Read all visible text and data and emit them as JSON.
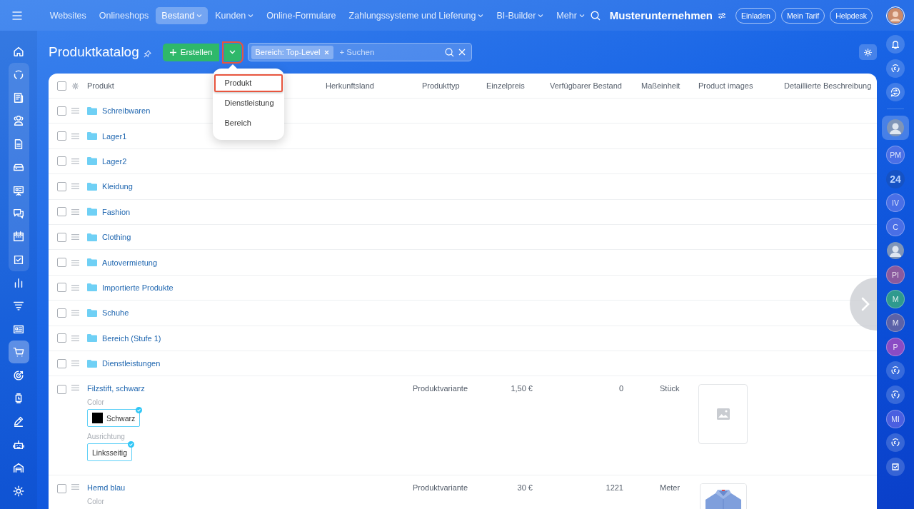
{
  "top_nav": {
    "items": [
      {
        "label": "Websites",
        "selected": false,
        "dropdown": false
      },
      {
        "label": "Onlineshops",
        "selected": false,
        "dropdown": false
      },
      {
        "label": "Bestand",
        "selected": true,
        "dropdown": true
      },
      {
        "label": "Kunden",
        "selected": false,
        "dropdown": true
      },
      {
        "label": "Online-Formulare",
        "selected": false,
        "dropdown": false
      },
      {
        "label": "Zahlungssysteme und Lieferung",
        "selected": false,
        "dropdown": true
      },
      {
        "label": "BI-Builder",
        "selected": false,
        "dropdown": true
      },
      {
        "label": "Mehr",
        "selected": false,
        "dropdown": true
      }
    ],
    "company": "Musterunternehmen",
    "buttons": [
      "Einladen",
      "Mein Tarif",
      "Helpdesk"
    ]
  },
  "left_sidebar": {
    "items": [
      {
        "selected": false,
        "grouped": false
      },
      {
        "selected": false,
        "grouped": true
      },
      {
        "selected": false,
        "grouped": true
      },
      {
        "selected": false,
        "grouped": true
      },
      {
        "selected": false,
        "grouped": true
      },
      {
        "selected": false,
        "grouped": true
      },
      {
        "selected": false,
        "grouped": true
      },
      {
        "selected": false,
        "grouped": true
      },
      {
        "selected": false,
        "grouped": true
      },
      {
        "selected": false,
        "grouped": true
      },
      {
        "selected": false,
        "grouped": false
      },
      {
        "selected": false,
        "grouped": false
      },
      {
        "selected": false,
        "grouped": false
      },
      {
        "selected": true,
        "grouped": false
      },
      {
        "selected": false,
        "grouped": false
      },
      {
        "selected": false,
        "grouped": false
      },
      {
        "selected": false,
        "grouped": false
      },
      {
        "selected": false,
        "grouped": false
      },
      {
        "selected": false,
        "grouped": false
      },
      {
        "selected": false,
        "grouped": false
      }
    ]
  },
  "toolbar": {
    "title": "Produktkatalog",
    "create_button": "Erstellen",
    "create_toggle_highlighted": true,
    "filter_chip": "Bereich: Top-Level",
    "search_placeholder": "+ Suchen"
  },
  "create_menu": {
    "items": [
      {
        "label": "Produkt",
        "selected": true
      },
      {
        "label": "Dienstleistung",
        "selected": false
      },
      {
        "label": "Bereich",
        "selected": false
      }
    ]
  },
  "table": {
    "select_all_checked": false,
    "columns": [
      "Produkt",
      "Herkunftsland",
      "Produkttyp",
      "Einzelpreis",
      "Verfügbarer Bestand",
      "Maßeinheit",
      "Product images",
      "Detaillierte Beschreibung"
    ],
    "rows": [
      {
        "kind": "folder",
        "name": "Schreibwaren",
        "checked": false
      },
      {
        "kind": "folder",
        "name": "Lager1",
        "checked": false
      },
      {
        "kind": "folder",
        "name": "Lager2",
        "checked": false
      },
      {
        "kind": "folder",
        "name": "Kleidung",
        "checked": false
      },
      {
        "kind": "folder",
        "name": "Fashion",
        "checked": false
      },
      {
        "kind": "folder",
        "name": "Clothing",
        "checked": false
      },
      {
        "kind": "folder",
        "name": "Autovermietung",
        "checked": false
      },
      {
        "kind": "folder",
        "name": "Importierte Produkte",
        "checked": false
      },
      {
        "kind": "folder",
        "name": "Schuhe",
        "checked": false
      },
      {
        "kind": "folder",
        "name": "Bereich (Stufe 1)",
        "checked": false
      },
      {
        "kind": "folder",
        "name": "Dienstleistungen",
        "checked": false
      },
      {
        "kind": "product",
        "name": "Filzstift, schwarz",
        "checked": false,
        "type": "Produktvariante",
        "price": "1,50 €",
        "stock": "0",
        "unit": "Stück",
        "image": {
          "kind": "placeholder"
        },
        "properties": [
          {
            "label": "Color",
            "value": "Schwarz",
            "color": "#000000"
          },
          {
            "label": "Ausrichtung",
            "value": "Linksseitig"
          }
        ]
      },
      {
        "kind": "product",
        "name": "Hemd blau",
        "checked": false,
        "type": "Produktvariante",
        "price": "30 €",
        "stock": "1221",
        "unit": "Meter",
        "image": {
          "kind": "picture"
        },
        "properties": [
          {
            "label": "Color"
          }
        ]
      }
    ]
  },
  "right_sidebar": {
    "items": [
      {
        "kind": "icon",
        "selected": false
      },
      {
        "kind": "icon",
        "selected": false
      },
      {
        "kind": "icon",
        "selected": false
      },
      {
        "kind": "avatar",
        "selected": true
      },
      {
        "kind": "initials",
        "text": "PM",
        "color": "#4a6fe6",
        "selected": false
      },
      {
        "kind": "logo",
        "text": "24",
        "selected": false
      },
      {
        "kind": "initials",
        "text": "IV",
        "color": "#4a6fe6",
        "selected": false
      },
      {
        "kind": "initials",
        "text": "C",
        "color": "#4a6fe6",
        "selected": false
      },
      {
        "kind": "avatar",
        "selected": false
      },
      {
        "kind": "initials",
        "text": "PI",
        "color": "#8a5a9e",
        "selected": false
      },
      {
        "kind": "initials",
        "text": "M",
        "color": "#2f9a8e",
        "selected": false
      },
      {
        "kind": "initials",
        "text": "M",
        "color": "#5b62a8",
        "selected": false
      },
      {
        "kind": "initials",
        "text": "P",
        "color": "#8a4cc4",
        "selected": false
      },
      {
        "kind": "icon",
        "selected": false
      },
      {
        "kind": "icon",
        "selected": false
      },
      {
        "kind": "initials",
        "text": "MI",
        "color": "#4a5fe0",
        "selected": false
      },
      {
        "kind": "icon",
        "selected": false
      },
      {
        "kind": "icon",
        "selected": false
      }
    ]
  }
}
